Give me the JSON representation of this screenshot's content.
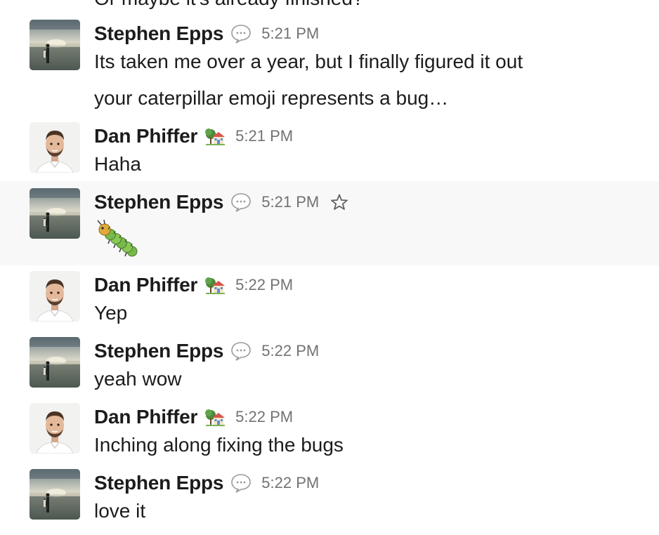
{
  "chat": {
    "partial_top": "Or maybe it's already finished?",
    "messages": [
      {
        "author": "Stephen Epps",
        "status": "speech-balloon",
        "time": "5:21 PM",
        "lines": [
          "Its taken me over a year, but I finally figured it out",
          "your caterpillar emoji represents a bug…"
        ]
      },
      {
        "author": "Dan Phiffer",
        "status": "house-with-garden",
        "time": "5:21 PM",
        "lines": [
          "Haha"
        ]
      },
      {
        "author": "Stephen Epps",
        "status": "speech-balloon",
        "time": "5:21 PM",
        "lines": [],
        "emoji": "bug-caterpillar"
      },
      {
        "author": "Dan Phiffer",
        "status": "house-with-garden",
        "time": "5:22 PM",
        "lines": [
          "Yep"
        ]
      },
      {
        "author": "Stephen Epps",
        "status": "speech-balloon",
        "time": "5:22 PM",
        "lines": [
          "yeah wow"
        ]
      },
      {
        "author": "Dan Phiffer",
        "status": "house-with-garden",
        "time": "5:22 PM",
        "lines": [
          "Inching along fixing the bugs"
        ]
      },
      {
        "author": "Stephen Epps",
        "status": "speech-balloon",
        "time": "5:22 PM",
        "lines": [
          "love it"
        ]
      }
    ]
  },
  "icons": {
    "star": "star-outline-icon"
  },
  "colors": {
    "hover_bg": "#f8f8f8",
    "text": "#1d1c1d",
    "timestamp": "#717274"
  }
}
